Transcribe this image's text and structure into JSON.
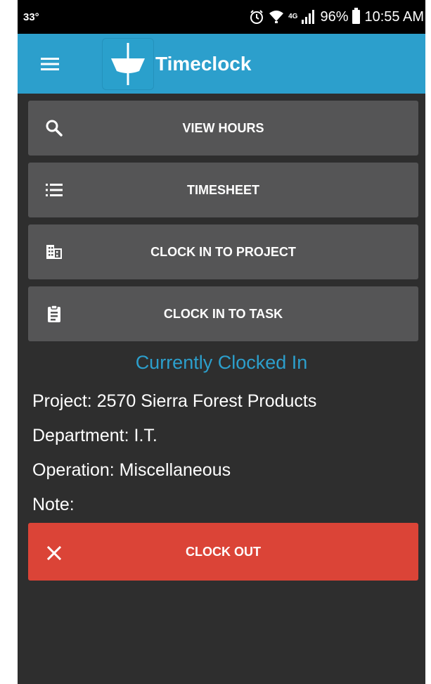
{
  "status_bar": {
    "temperature": "33°",
    "network_label": "4G",
    "battery": "96%",
    "time": "10:55 AM"
  },
  "app_bar": {
    "title": "Timeclock",
    "color": "#2c9fcc"
  },
  "actions": [
    {
      "label": "VIEW HOURS",
      "icon": "search-icon"
    },
    {
      "label": "TIMESHEET",
      "icon": "list-icon"
    },
    {
      "label": "CLOCK IN TO PROJECT",
      "icon": "building-icon"
    },
    {
      "label": "CLOCK IN TO TASK",
      "icon": "clipboard-icon"
    }
  ],
  "clock_status": {
    "heading": "Currently Clocked In",
    "project": "Project: 2570 Sierra Forest Products",
    "department": "Department: I.T.",
    "operation": "Operation: Miscellaneous",
    "note": "Note:"
  },
  "clock_out": {
    "label": "CLOCK OUT",
    "icon": "close-icon",
    "color": "#db4437"
  }
}
